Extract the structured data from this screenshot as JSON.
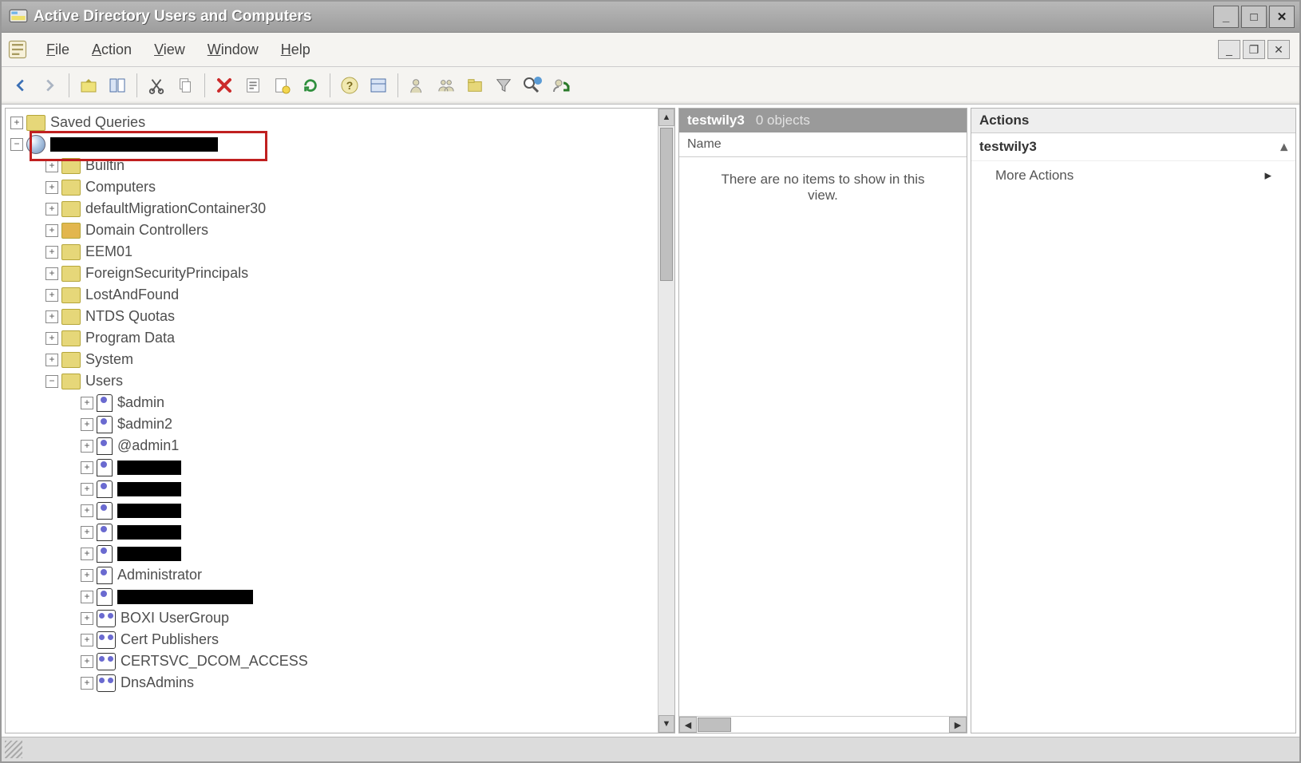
{
  "window": {
    "title": "Active Directory Users and Computers"
  },
  "menu": {
    "file": "File",
    "action": "Action",
    "view": "View",
    "window": "Window",
    "help": "Help"
  },
  "tree": {
    "saved_queries": "Saved Queries",
    "domain_redacted": true,
    "containers": [
      "Builtin",
      "Computers",
      "defaultMigrationContainer30",
      "Domain Controllers",
      "EEM01",
      "ForeignSecurityPrincipals",
      "LostAndFound",
      "NTDS Quotas",
      "Program Data",
      "System",
      "Users"
    ],
    "users": [
      {
        "label": "$admin",
        "type": "user"
      },
      {
        "label": "$admin2",
        "type": "user"
      },
      {
        "label": "@admin1",
        "type": "user"
      },
      {
        "label": "",
        "type": "user",
        "redacted": true,
        "redact_w": 80
      },
      {
        "label": "",
        "type": "user",
        "redacted": true,
        "redact_w": 80
      },
      {
        "label": "",
        "type": "user",
        "redacted": true,
        "redact_w": 80
      },
      {
        "label": "",
        "type": "user",
        "redacted": true,
        "redact_w": 80
      },
      {
        "label": "",
        "type": "user",
        "redacted": true,
        "redact_w": 80
      },
      {
        "label": "Administrator",
        "type": "user"
      },
      {
        "label": "",
        "type": "user",
        "redacted": true,
        "redact_w": 170
      },
      {
        "label": "BOXI UserGroup",
        "type": "group"
      },
      {
        "label": "Cert Publishers",
        "type": "group"
      },
      {
        "label": "CERTSVC_DCOM_ACCESS",
        "type": "group"
      },
      {
        "label": "DnsAdmins",
        "type": "group"
      }
    ]
  },
  "middle": {
    "title": "testwily3",
    "count": "0 objects",
    "column": "Name",
    "empty": "There are no items to show in this view."
  },
  "actions": {
    "header": "Actions",
    "context": "testwily3",
    "more": "More Actions"
  }
}
